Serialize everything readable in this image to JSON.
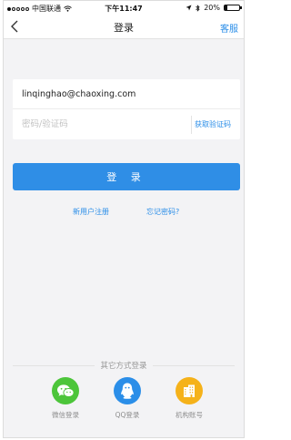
{
  "status_bar": {
    "carrier": "中国联通",
    "time": "下午11:47",
    "battery_percent": "20%",
    "battery_level": 0.2
  },
  "nav": {
    "title": "登录",
    "service_label": "客服"
  },
  "form": {
    "account_value": "linqinghao@chaoxing.com",
    "password_placeholder": "密码/验证码",
    "get_code_label": "获取验证码",
    "login_label": "登 录"
  },
  "links": {
    "register": "新用户注册",
    "forgot": "忘记密码?"
  },
  "other_login": {
    "title": "其它方式登录",
    "options": [
      {
        "label": "微信登录",
        "icon": "wechat-icon",
        "color": "#4cc53a"
      },
      {
        "label": "QQ登录",
        "icon": "qq-icon",
        "color": "#2b8ee8"
      },
      {
        "label": "机构账号",
        "icon": "building-icon",
        "color": "#f5b21a"
      }
    ]
  },
  "colors": {
    "accent": "#2f8ee6",
    "background": "#f3f3f5"
  }
}
